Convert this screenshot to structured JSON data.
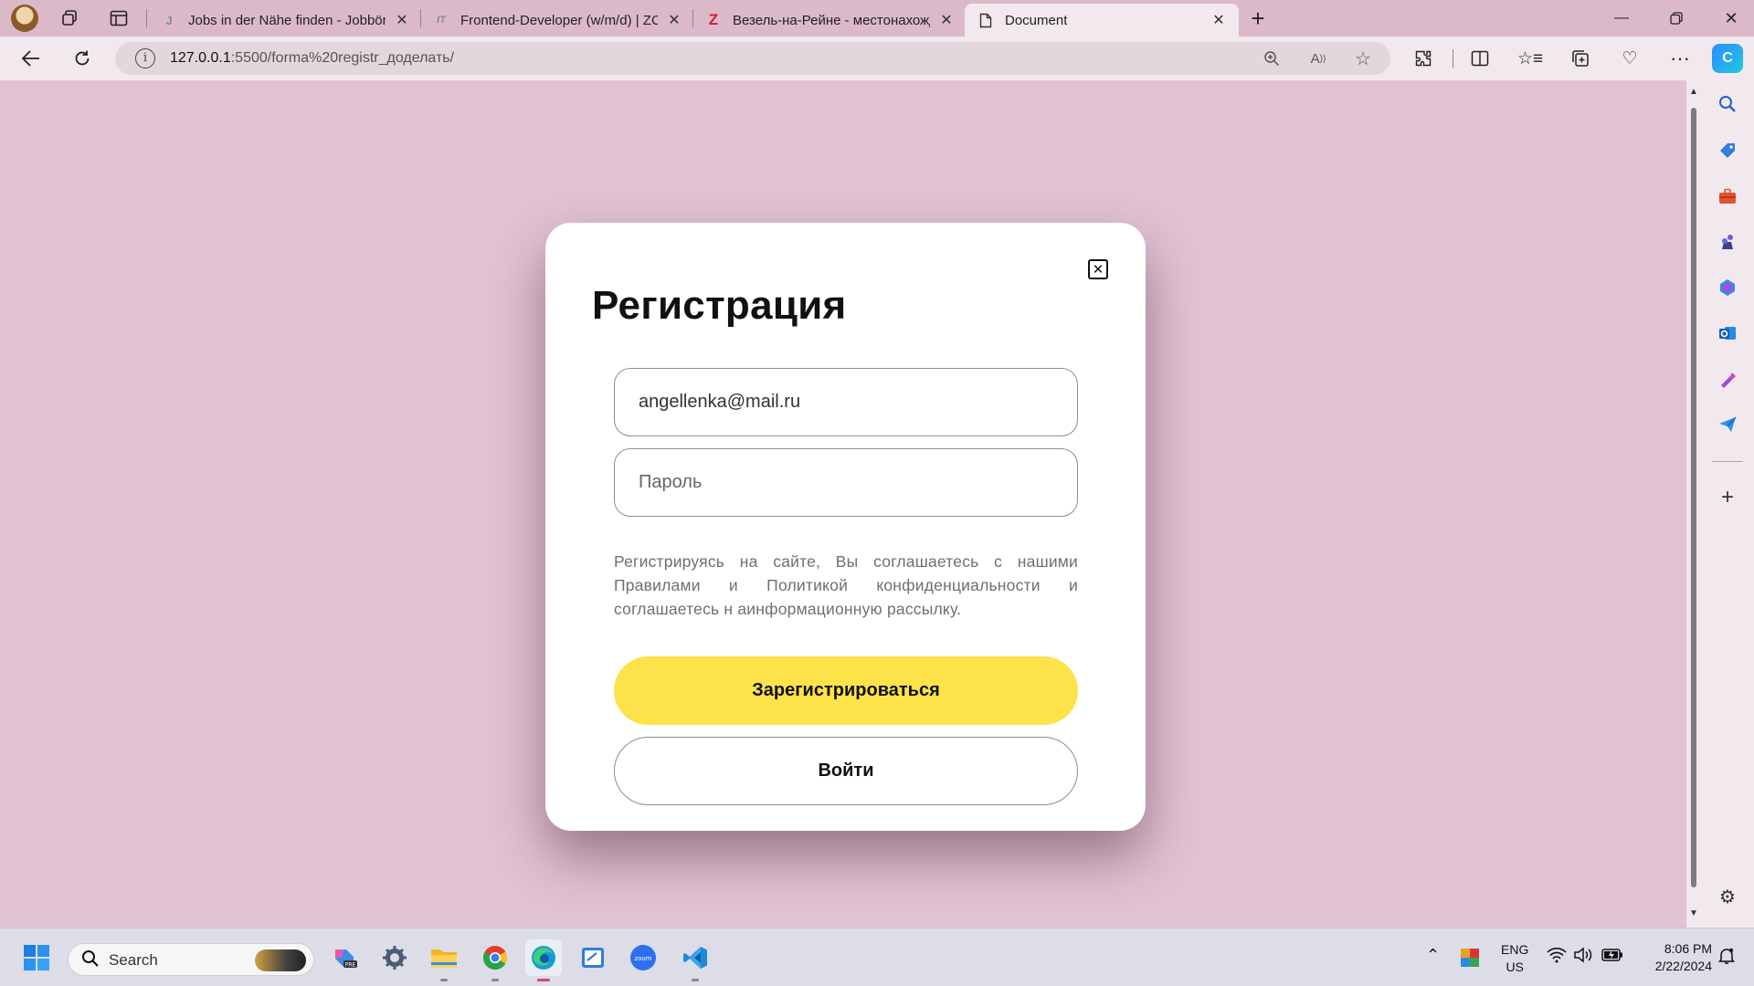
{
  "browser": {
    "tabs": [
      {
        "title": "Jobs in der Nähe finden - Jobbör",
        "favicon": "J",
        "active": false
      },
      {
        "title": "Frontend-Developer (w/m/d) | ZC",
        "favicon": "IT",
        "active": false
      },
      {
        "title": "Везель-на-Рейне - местонахожд",
        "favicon": "Z",
        "active": false
      },
      {
        "title": "Document",
        "favicon": "doc",
        "active": true
      }
    ],
    "url_host": "127.0.0.1",
    "url_path": ":5500/forma%20registr_доделать/"
  },
  "modal": {
    "title": "Регистрация",
    "email_value": "angellenka@mail.ru",
    "password_placeholder": "Пароль",
    "consent_text": "Регистрируясь на сайте, Вы соглашаетесь с нашими Правилами и Политикой конфиденциальности и соглашаетесь н аинформационную рассылку.",
    "register_button": "Зарегистрироваться",
    "login_button": "Войти"
  },
  "taskbar": {
    "search_label": "Search",
    "lang_line1": "ENG",
    "lang_line2": "US",
    "time": "8:06 PM",
    "date": "2/22/2024"
  },
  "colors": {
    "page_background": "#e2c3d3",
    "primary_button": "#fde24a",
    "modal_background": "#ffffff"
  }
}
